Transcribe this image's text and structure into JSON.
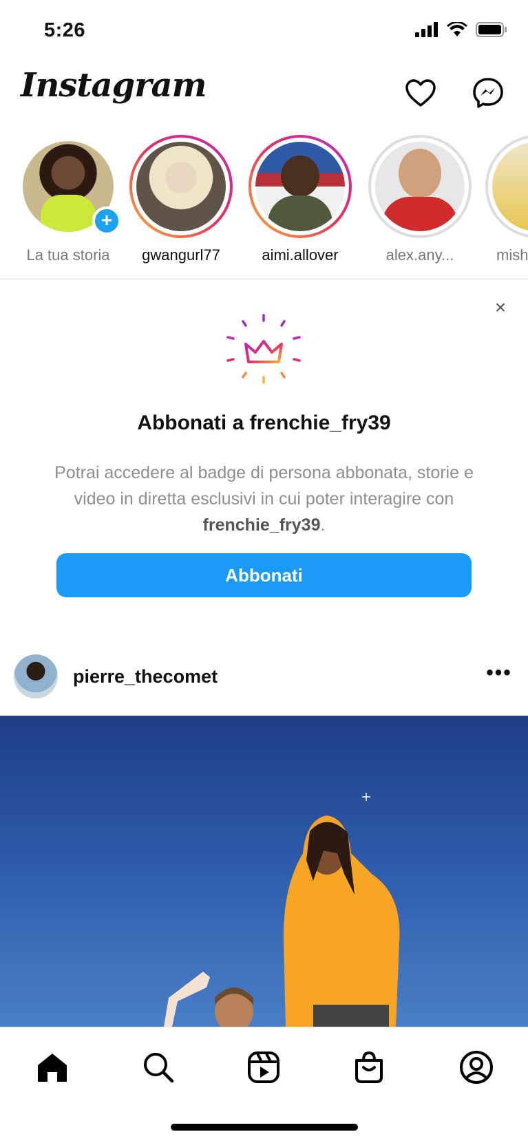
{
  "status_bar": {
    "time": "5:26"
  },
  "header": {
    "logo": "Instagram",
    "icons": [
      "heart-icon",
      "messenger-icon"
    ]
  },
  "stories": [
    {
      "label": "La tua storia",
      "own": true
    },
    {
      "label": "gwangurl77",
      "ring": "gradient"
    },
    {
      "label": "aimi.allover",
      "ring": "gradient"
    },
    {
      "label": "alex.any...",
      "ring": "seen"
    },
    {
      "label": "mish",
      "ring": "seen"
    }
  ],
  "subscribe_card": {
    "icon": "crown-icon",
    "title": "Abbonati a frenchie_fry39",
    "description_before": "Potrai accedere al badge di persona abbonata, storie e video in diretta esclusivi in cui poter interagire con ",
    "description_bold": "frenchie_fry39",
    "description_after": ".",
    "button_label": "Abbonati",
    "close_label": "×"
  },
  "post": {
    "username": "pierre_thecomet",
    "more_label": "•••"
  },
  "tab_bar": {
    "items": [
      "home-icon",
      "search-icon",
      "reels-icon",
      "shop-icon",
      "profile-icon"
    ]
  },
  "colors": {
    "accent": "#1b9af7",
    "story_gradient": [
      "#f9b338",
      "#e8305e",
      "#b42cb9"
    ]
  }
}
